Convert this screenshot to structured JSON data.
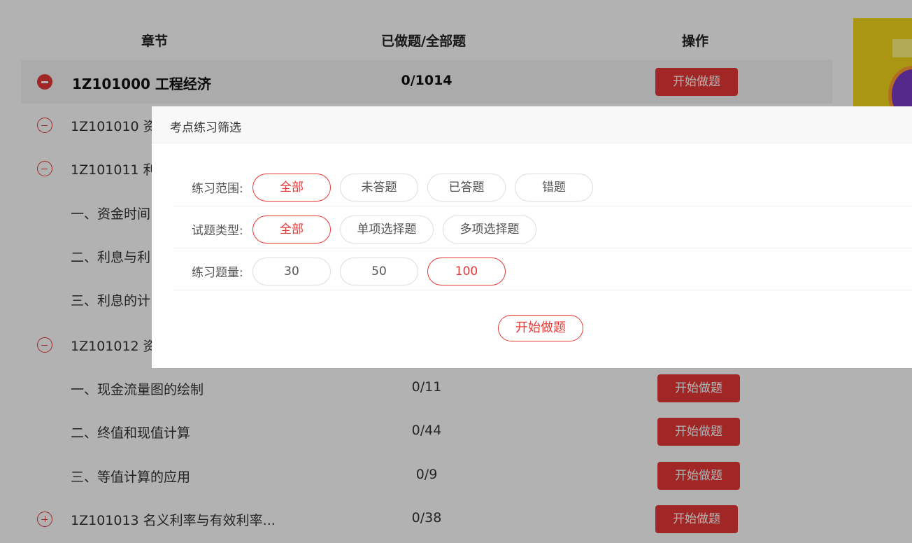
{
  "table": {
    "headers": {
      "chapter": "章节",
      "progress": "已做题/全部题",
      "action": "操作"
    },
    "rows": [
      {
        "title": "1Z101000 工程经济",
        "count": "0/1014",
        "action": "开始做题"
      },
      {
        "title": "1Z101010 资"
      },
      {
        "title": "1Z101011 利"
      },
      {
        "title": "一、资金时间"
      },
      {
        "title": "二、利息与利"
      },
      {
        "title": "三、利息的计"
      },
      {
        "title": "1Z101012 资"
      },
      {
        "title": "一、现金流量图的绘制",
        "count": "0/11",
        "action": "开始做题"
      },
      {
        "title": "二、终值和现值计算",
        "count": "0/44",
        "action": "开始做题"
      },
      {
        "title": "三、等值计算的应用",
        "count": "0/9",
        "action": "开始做题"
      },
      {
        "title": "1Z101013 名义利率与有效利率...",
        "count": "0/38",
        "action": "开始做题"
      }
    ]
  },
  "modal": {
    "title": "考点练习筛选",
    "scope": {
      "label": "练习范围:",
      "options": [
        "全部",
        "未答题",
        "已答题",
        "错题"
      ],
      "selected": "全部"
    },
    "type": {
      "label": "试题类型:",
      "options": [
        "全部",
        "单项选择题",
        "多项选择题"
      ],
      "selected": "全部"
    },
    "quantity": {
      "label": "练习题量:",
      "options": [
        "30",
        "50",
        "100"
      ],
      "selected": "100"
    },
    "start_label": "开始做题"
  },
  "colors": {
    "accent": "#e53935",
    "overlay": "rgba(0,0,0,0.3)"
  },
  "icons": {
    "collapse": "minus-circle-icon",
    "expand": "plus-circle-icon"
  }
}
